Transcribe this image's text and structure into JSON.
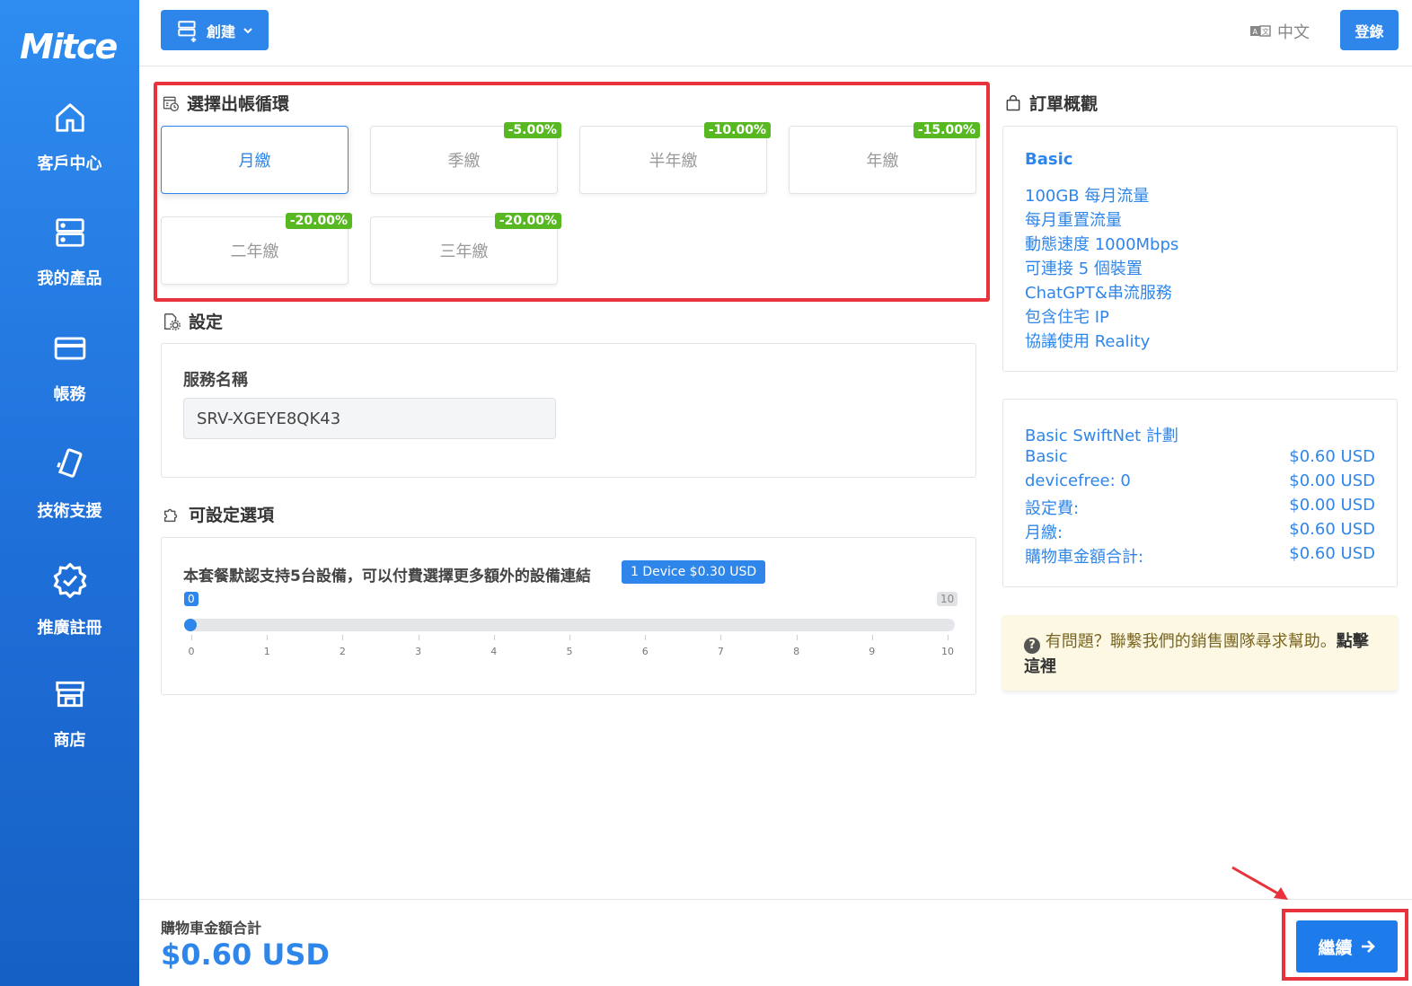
{
  "brand": {
    "name": "Mitce"
  },
  "sidebar": {
    "items": [
      {
        "label": "客戶中心",
        "icon": "home-icon"
      },
      {
        "label": "我的產品",
        "icon": "server-icon"
      },
      {
        "label": "帳務",
        "icon": "credit-card-icon"
      },
      {
        "label": "技術支援",
        "icon": "ticket-icon"
      },
      {
        "label": "推廣註冊",
        "icon": "badge-check-icon"
      },
      {
        "label": "商店",
        "icon": "store-icon"
      }
    ]
  },
  "topbar": {
    "create_label": "創建",
    "language": "中文",
    "login_label": "登錄"
  },
  "billing": {
    "heading": "選擇出帳循環",
    "options": [
      {
        "label": "月繳",
        "discount": "",
        "selected": true
      },
      {
        "label": "季繳",
        "discount": "-5.00%",
        "selected": false
      },
      {
        "label": "半年繳",
        "discount": "-10.00%",
        "selected": false
      },
      {
        "label": "年繳",
        "discount": "-15.00%",
        "selected": false
      },
      {
        "label": "二年繳",
        "discount": "-20.00%",
        "selected": false
      },
      {
        "label": "三年繳",
        "discount": "-20.00%",
        "selected": false
      }
    ]
  },
  "settings": {
    "heading": "設定",
    "service_name_label": "服務名稱",
    "service_name_value": "SRV-XGEYE8QK43"
  },
  "options": {
    "heading": "可設定選項",
    "device_text": "本套餐默認支持5台設備，可以付費選擇更多額外的設備連結",
    "device_badge": "1 Device $0.30 USD",
    "slider": {
      "value": 0,
      "min": 0,
      "max": 10,
      "min_label": "0",
      "max_label": "10",
      "ticks": [
        "0",
        "1",
        "2",
        "3",
        "4",
        "5",
        "6",
        "7",
        "8",
        "9",
        "10"
      ]
    }
  },
  "summary": {
    "heading": "訂單概觀",
    "plan": "Basic",
    "features": [
      "100GB 每月流量",
      "每月重置流量",
      "動態速度 1000Mbps",
      "可連接 5 個裝置",
      "ChatGPT&串流服務",
      "包含住宅 IP",
      "協議使用 Reality"
    ],
    "plan_title": "Basic SwiftNet 計劃",
    "lines": [
      {
        "label": "Basic",
        "value": "$0.60 USD"
      },
      {
        "label": "devicefree: 0",
        "value": "$0.00 USD"
      },
      {
        "label": "設定費:",
        "value": "$0.00 USD"
      },
      {
        "label": "月繳:",
        "value": "$0.60 USD"
      },
      {
        "label": "購物車金額合計:",
        "value": "$0.60 USD"
      }
    ]
  },
  "help": {
    "text": "有問題？聯繫我們的銷售團隊尋求幫助。",
    "link": "點擊這裡"
  },
  "footer": {
    "total_label": "購物車金額合計",
    "total_value": "$0.60 USD",
    "continue_label": "繼續"
  },
  "colors": {
    "accent": "#2f86ea",
    "sidebar": "#1f6fd9",
    "discount": "#57b822",
    "highlight": "#e8333c",
    "help_bg": "#fcf8e3"
  }
}
